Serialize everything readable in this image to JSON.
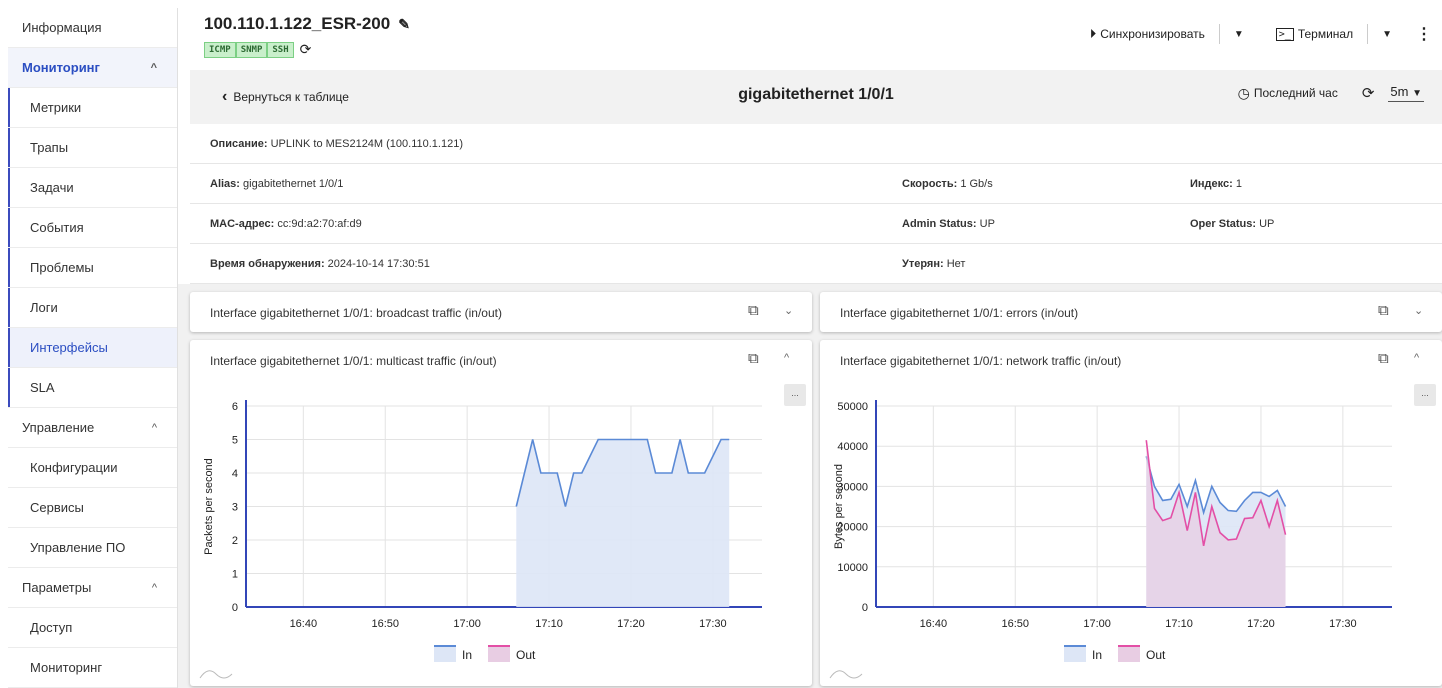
{
  "sidebar": {
    "items": [
      {
        "label": "Информация",
        "kind": "top"
      },
      {
        "label": "Мониторинг",
        "kind": "section-active"
      },
      {
        "label": "Метрики",
        "kind": "sub"
      },
      {
        "label": "Трапы",
        "kind": "sub"
      },
      {
        "label": "Задачи",
        "kind": "sub"
      },
      {
        "label": "События",
        "kind": "sub"
      },
      {
        "label": "Проблемы",
        "kind": "sub"
      },
      {
        "label": "Логи",
        "kind": "sub"
      },
      {
        "label": "Интерфейсы",
        "kind": "sub-selected"
      },
      {
        "label": "SLA",
        "kind": "sub"
      },
      {
        "label": "Управление",
        "kind": "section"
      },
      {
        "label": "Конфигурации",
        "kind": "child"
      },
      {
        "label": "Сервисы",
        "kind": "child"
      },
      {
        "label": "Управление ПО",
        "kind": "child"
      },
      {
        "label": "Параметры",
        "kind": "section"
      },
      {
        "label": "Доступ",
        "kind": "child"
      },
      {
        "label": "Мониторинг",
        "kind": "child"
      }
    ]
  },
  "header": {
    "device_name": "100.110.1.122_ESR-200",
    "badges": [
      "ICMP",
      "SNMP",
      "SSH"
    ],
    "sync_label": "Синхронизировать",
    "terminal_label": "Терминал"
  },
  "subheader": {
    "back_label": "Вернуться к таблице",
    "interface_title": "gigabitethernet 1/0/1",
    "time_range": "Последний час",
    "refresh_interval": "5m"
  },
  "info": {
    "description_label": "Описание:",
    "description_value": "UPLINK to MES2124M (100.110.1.121)",
    "alias_label": "Alias:",
    "alias_value": "gigabitethernet 1/0/1",
    "speed_label": "Скорость:",
    "speed_value": "1 Gb/s",
    "index_label": "Индекс:",
    "index_value": "1",
    "mac_label": "MAC-адрес:",
    "mac_value": "cc:9d:a2:70:af:d9",
    "admin_label": "Admin Status:",
    "admin_value": "UP",
    "oper_label": "Oper Status:",
    "oper_value": "UP",
    "discovery_label": "Время обнаружения:",
    "discovery_value": "2024-10-14 17:30:51",
    "lost_label": "Утерян:",
    "lost_value": "Нет"
  },
  "panels": {
    "broadcast_title": "Interface gigabitethernet 1/0/1: broadcast traffic (in/out)",
    "errors_title": "Interface gigabitethernet 1/0/1: errors (in/out)",
    "multicast_title": "Interface gigabitethernet 1/0/1: multicast traffic (in/out)",
    "network_title": "Interface gigabitethernet 1/0/1: network traffic (in/out)",
    "more_label": "..."
  },
  "colors": {
    "accent": "#2b4ec2",
    "in_line": "#5b8ad6",
    "in_fill": "#dde6f6",
    "out_line": "#e34fa6",
    "out_fill": "#e8cde3"
  },
  "chart_data": [
    {
      "type": "area",
      "title": "Interface gigabitethernet 1/0/1: multicast traffic (in/out)",
      "ylabel": "Packets per second",
      "ylim": [
        0,
        6
      ],
      "yticks": [
        0,
        1,
        2,
        3,
        4,
        5,
        6
      ],
      "xticks": [
        "16:40",
        "16:50",
        "17:00",
        "17:10",
        "17:20",
        "17:30"
      ],
      "xrange": [
        "16:33",
        "17:36"
      ],
      "x": [
        "17:06",
        "17:08",
        "17:09",
        "17:10",
        "17:11",
        "17:12",
        "17:13",
        "17:14",
        "17:15",
        "17:16",
        "17:17",
        "17:18",
        "17:19",
        "17:20",
        "17:21",
        "17:22",
        "17:23",
        "17:24",
        "17:25",
        "17:26",
        "17:27",
        "17:28",
        "17:29",
        "17:30",
        "17:31",
        "17:32"
      ],
      "series": [
        {
          "name": "In",
          "values": [
            3,
            5,
            4,
            4,
            4,
            3,
            4,
            4,
            4.5,
            5,
            5,
            5,
            5,
            5,
            5,
            5,
            4,
            4,
            4,
            5,
            4,
            4,
            4,
            4.5,
            5,
            5
          ]
        },
        {
          "name": "Out",
          "values": [
            0,
            0,
            0,
            0,
            0,
            0,
            0,
            0,
            0,
            0,
            0,
            0,
            0,
            0,
            0,
            0,
            0,
            0,
            0,
            0,
            0,
            0,
            0,
            0,
            0,
            0
          ]
        }
      ],
      "legend": [
        "In",
        "Out"
      ],
      "legend_position": "bottom"
    },
    {
      "type": "area",
      "title": "Interface gigabitethernet 1/0/1: network traffic (in/out)",
      "ylabel": "Bytes per second",
      "ylim": [
        0,
        50000
      ],
      "yticks": [
        0,
        10000,
        20000,
        30000,
        40000,
        50000
      ],
      "xticks": [
        "16:40",
        "16:50",
        "17:00",
        "17:10",
        "17:20",
        "17:30"
      ],
      "xrange": [
        "16:33",
        "17:36"
      ],
      "x": [
        "17:06",
        "17:07",
        "17:08",
        "17:09",
        "17:10",
        "17:11",
        "17:12",
        "17:13",
        "17:14",
        "17:15",
        "17:16",
        "17:17",
        "17:18",
        "17:19",
        "17:20",
        "17:21",
        "17:22",
        "17:23",
        "17:24",
        "17:25",
        "17:26",
        "17:27",
        "17:28",
        "17:29",
        "17:30",
        "17:31"
      ],
      "series": [
        {
          "name": "In",
          "values": [
            37500,
            30000,
            26500,
            26800,
            30500,
            25000,
            31500,
            23500,
            30000,
            26000,
            24000,
            23800,
            26500,
            28500,
            28500,
            27500,
            29000,
            25000,
            0,
            0,
            0,
            0,
            0,
            0,
            0,
            0
          ]
        },
        {
          "name": "Out",
          "values": [
            41500,
            24500,
            21500,
            22200,
            28500,
            19000,
            28500,
            15200,
            25000,
            18500,
            16700,
            16900,
            22000,
            22200,
            26500,
            20000,
            26500,
            18000,
            0,
            0,
            0,
            0,
            0,
            0,
            0,
            0
          ]
        }
      ],
      "legend": [
        "In",
        "Out"
      ],
      "legend_position": "bottom"
    }
  ]
}
